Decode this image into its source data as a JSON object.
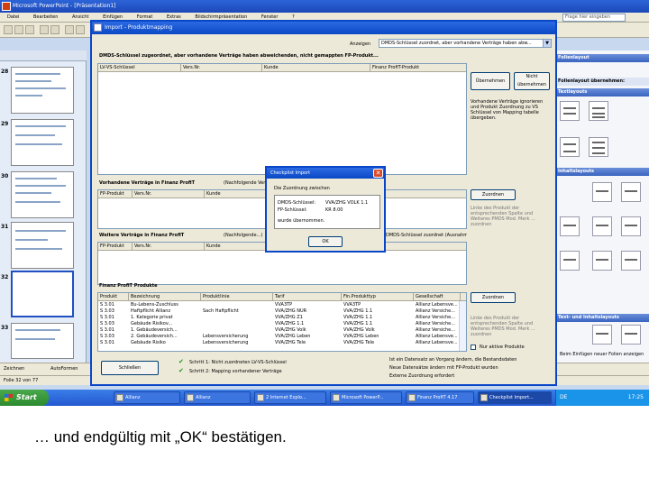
{
  "powerpoint": {
    "title": "Microsoft PowerPoint - [Präsentation1]",
    "menu": [
      "Datei",
      "Bearbeiten",
      "Ansicht",
      "Einfügen",
      "Format",
      "Extras",
      "Bildschirmpräsentation",
      "Fenster",
      "?"
    ],
    "help_placeholder": "Frage hier eingeben",
    "slide_numbers": [
      "28",
      "29",
      "30",
      "31",
      "32",
      "33"
    ],
    "drawbar": {
      "zeichnen": "Zeichnen",
      "autoformen": "AutoFormen"
    },
    "status": "Folie 32 von 77"
  },
  "taskpane": {
    "headers": [
      "Folienlayout",
      "Folienlayout übernehmen:",
      "Textlayouts",
      "Inhaltslayouts",
      "Text- und Inhaltslayouts"
    ],
    "footer": "Beim Einfügen neuer Folien anzeigen"
  },
  "dialog": {
    "title": "Import - Produktmapping",
    "section1": "DMDS-Schlüssel zugeordnet, aber vorhandene Verträge haben abweichenden, nicht gemappten FP-Produkt...",
    "anzeigen_label": "Anzeigen",
    "anzeigen_value": "DMDS-Schlüssel zuordnet, aber vorhandene Verträge haben abw...",
    "grid1_headers": [
      "LV-VS-Schlüssel",
      "Vers.Nr.",
      "Kunde",
      "Finanz ProfiT-Produkt"
    ],
    "btn_uebernehmen": "Übernehmen",
    "btn_nicht_uebernehmen": "Nicht übernehmen",
    "side_text1": "Vorhandene Verträge ignorieren und Produkt Zuordnung zu VS Schlüssel von Mapping tabelle übergeben.",
    "section2": "Vorhandene Verträge in Finanz ProfiT",
    "section2_note": "(Nachfolgende Verträge...)",
    "grid2_headers": [
      "FP-Produkt",
      "Vers.Nr.",
      "Kunde"
    ],
    "btn_zuordnen1": "Zuordnen",
    "side_text2": "Linke des Produkt der entsprechenden Spalte und Weiteres PMDS Mod. Merk ... zuordnen",
    "section3": "Weitere Verträge in Finanz ProfiT",
    "section3_note": "(Nachfolgende...)",
    "section3_right": "DMDS-Schlüssel zuordnet (Ausnahme)",
    "grid3_headers": [
      "FP-Produkt",
      "Vers.Nr.",
      "Kunde"
    ],
    "section4": "Finanz ProfiT Produkte",
    "grid4_headers": [
      "Produkt",
      "Bezeichnung",
      "Produktlinie",
      "Tarif",
      "Fin.Produkttyp",
      "Gesellschaft"
    ],
    "grid4_rows": [
      [
        "S 3.01",
        "Bu-Lebens-Zuschluss",
        "",
        "VVA3TP",
        "VVA3TP",
        "Allianz Lebensve..."
      ],
      [
        "S 3.03",
        "Haftpflicht Allianz",
        "Sach Haftpflicht",
        "VVA/ZHG NUR",
        "VVA/ZHG 1.1",
        "Allianz Versiche..."
      ],
      [
        "S 3.01",
        "1. Kategorie privat",
        "",
        "VVA/ZHG Z1",
        "VVA/ZHG 1.1",
        "Allianz Versiche..."
      ],
      [
        "S 3.03",
        "Gebäude Risikov...",
        "",
        "VVA/ZHG 1.1",
        "VVA/ZHG 1.1",
        "Allianz Versiche..."
      ],
      [
        "S 3.01",
        "1. Gebäudeversich...",
        "",
        "VVA/ZHG Volk",
        "VVA/ZHG Volk",
        "Allianz Versiche..."
      ],
      [
        "S 3.03",
        "2. Gebäudeversich...",
        "Lebensversicherung",
        "VVA/ZHG Leben",
        "VVA/ZHG Leben",
        "Allianz Lebensve..."
      ],
      [
        "S 3.01",
        "Gebäude Risiko",
        "Lebensversicherung",
        "VVA/ZHG Tele",
        "VVA/ZHG Tele",
        "Allianz Lebensve..."
      ]
    ],
    "btn_zuordnen2": "Zuordnen",
    "side_text3": "Linke des Produkt der entsprechenden Spalte und Weiteres PMDS Mod. Merk ... zuordnen",
    "cb_label": "Nur aktive Produkte",
    "btn_schliessen": "Schließen",
    "step1": "Schritt 1: Nicht zuordneten LV-VS-Schlüssel",
    "step2": "Schritt 2: Mapping vorhandener Verträge",
    "bottom_text1": "Ist ein Datensatz an Vorgang ändern, die Bestandsdaten",
    "bottom_text2": "Neue Datensätze ändern mit FP-Produkt wurden",
    "bottom_text3": "Externe Zuordnung erfordert"
  },
  "popup": {
    "title": "Checkplist Import",
    "line1": "Die Zuordnung zwischen",
    "key1": "DMDS-Schlüssel:",
    "val1": "VVA/ZHG VOLK 1.1",
    "key2": "FP-Schlüssel:",
    "val2": "KR 8.00",
    "line3": "wurde übernommen.",
    "ok": "OK"
  },
  "taskbar": {
    "start": "Start",
    "items": [
      "Allianz",
      "Allianz",
      "2 Internet Explo...",
      "Microsoft PowerP...",
      "Finanz ProfiT 4.17",
      "Checkplist Import..."
    ],
    "tray_lang": "DE",
    "clock": "17:25"
  },
  "caption": "… und endgültig mit „OK“ bestätigen."
}
